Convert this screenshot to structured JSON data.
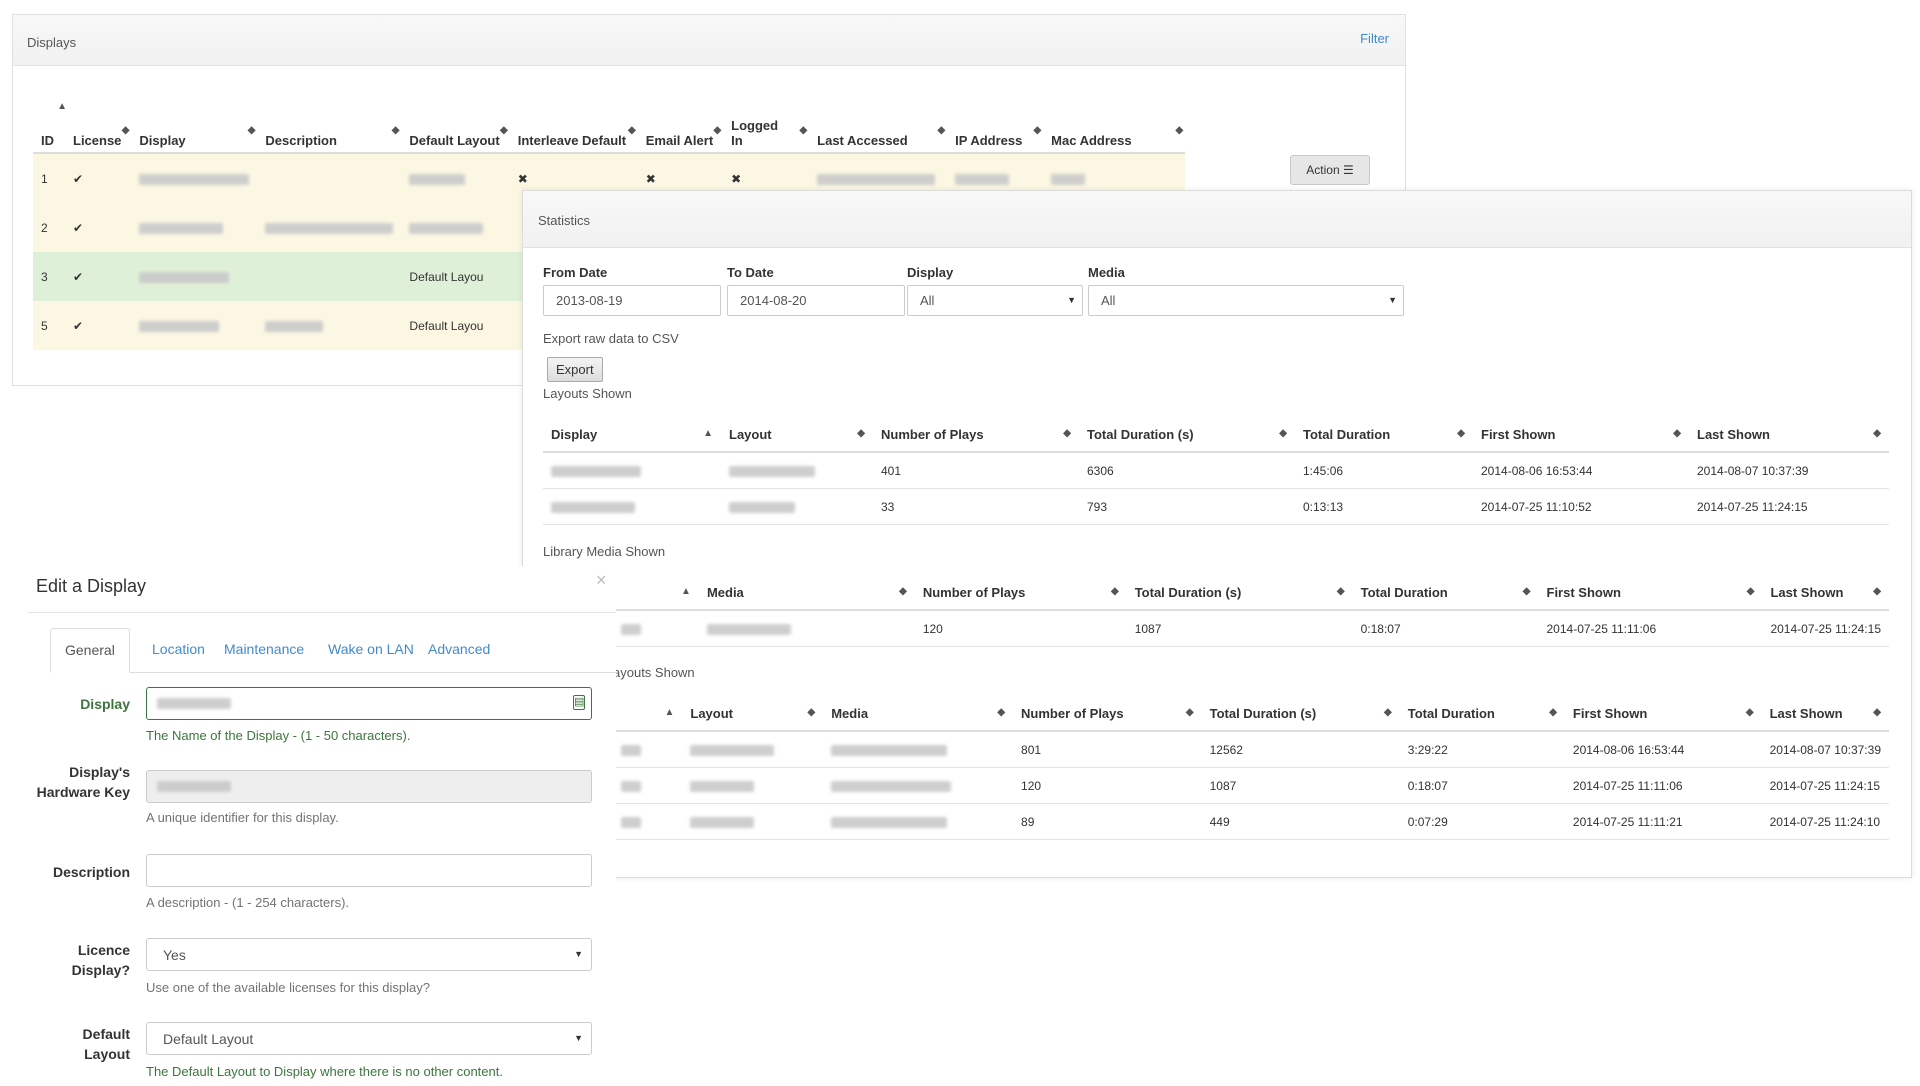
{
  "displays": {
    "title": "Displays",
    "filter_label": "Filter",
    "columns": [
      "ID",
      "License",
      "Display",
      "Description",
      "Default Layout",
      "Interleave Default",
      "Email Alert",
      "Logged\nIn",
      "Last Accessed",
      "IP Address",
      "Mac Address"
    ],
    "rows": [
      {
        "id": "1",
        "license": "✔",
        "default_layout": "",
        "interleave": "✖",
        "email": "✖",
        "logged": "✖"
      },
      {
        "id": "2",
        "license": "✔",
        "default_layout": ""
      },
      {
        "id": "3",
        "license": "✔",
        "default_layout": "Default Layou"
      },
      {
        "id": "5",
        "license": "✔",
        "default_layout": "Default Layou"
      }
    ],
    "action_label": "Action"
  },
  "statistics": {
    "title": "Statistics",
    "from_label": "From Date",
    "from_value": "2013-08-19",
    "to_label": "To Date",
    "to_value": "2014-08-20",
    "display_label": "Display",
    "display_value": "All",
    "media_label": "Media",
    "media_value": "All",
    "export_text": "Export raw data to CSV",
    "export_button": "Export",
    "layouts_shown_label": "Layouts Shown",
    "layouts_headers": [
      "Display",
      "Layout",
      "Number of Plays",
      "Total Duration (s)",
      "Total Duration",
      "First Shown",
      "Last Shown"
    ],
    "layouts_rows": [
      {
        "plays": "401",
        "dur_s": "6306",
        "dur": "1:45:06",
        "first": "2014-08-06 16:53:44",
        "last": "2014-08-07 10:37:39"
      },
      {
        "plays": "33",
        "dur_s": "793",
        "dur": "0:13:13",
        "first": "2014-07-25 11:10:52",
        "last": "2014-07-25 11:24:15"
      }
    ],
    "library_label": "Library Media Shown",
    "library_headers": [
      "Media",
      "Number of Plays",
      "Total Duration (s)",
      "Total Duration",
      "First Shown",
      "Last Shown"
    ],
    "library_rows": [
      {
        "plays": "120",
        "dur_s": "1087",
        "dur": "0:18:07",
        "first": "2014-07-25 11:11:06",
        "last": "2014-07-25 11:24:15"
      }
    ],
    "media_on_layouts_label": "ayouts Shown",
    "mol_headers": [
      "Layout",
      "Media",
      "Number of Plays",
      "Total Duration (s)",
      "Total Duration",
      "First Shown",
      "Last Shown"
    ],
    "mol_rows": [
      {
        "plays": "801",
        "dur_s": "12562",
        "dur": "3:29:22",
        "first": "2014-08-06 16:53:44",
        "last": "2014-08-07 10:37:39"
      },
      {
        "plays": "120",
        "dur_s": "1087",
        "dur": "0:18:07",
        "first": "2014-07-25 11:11:06",
        "last": "2014-07-25 11:24:15"
      },
      {
        "plays": "89",
        "dur_s": "449",
        "dur": "0:07:29",
        "first": "2014-07-25 11:11:21",
        "last": "2014-07-25 11:24:10"
      }
    ]
  },
  "edit": {
    "title": "Edit a Display",
    "close": "×",
    "tabs": [
      "General",
      "Location",
      "Maintenance",
      "Wake on LAN",
      "Advanced"
    ],
    "display_label": "Display",
    "display_help": "The Name of the Display - (1 - 50 characters).",
    "hwkey_label": "Display's Hardware Key",
    "hwkey_help": "A unique identifier for this display.",
    "description_label": "Description",
    "description_help": "A description - (1 - 254 characters).",
    "licence_label": "Licence Display?",
    "licence_value": "Yes",
    "licence_help": "Use one of the available licenses for this display?",
    "layout_label": "Default Layout",
    "layout_value": "Default Layout",
    "layout_help": "The Default Layout to Display where there is no other content."
  },
  "colors": {
    "link": "#428bca",
    "success": "#3c763d",
    "row_yellow": "#fbf7e3",
    "row_green": "#dff0d8"
  }
}
